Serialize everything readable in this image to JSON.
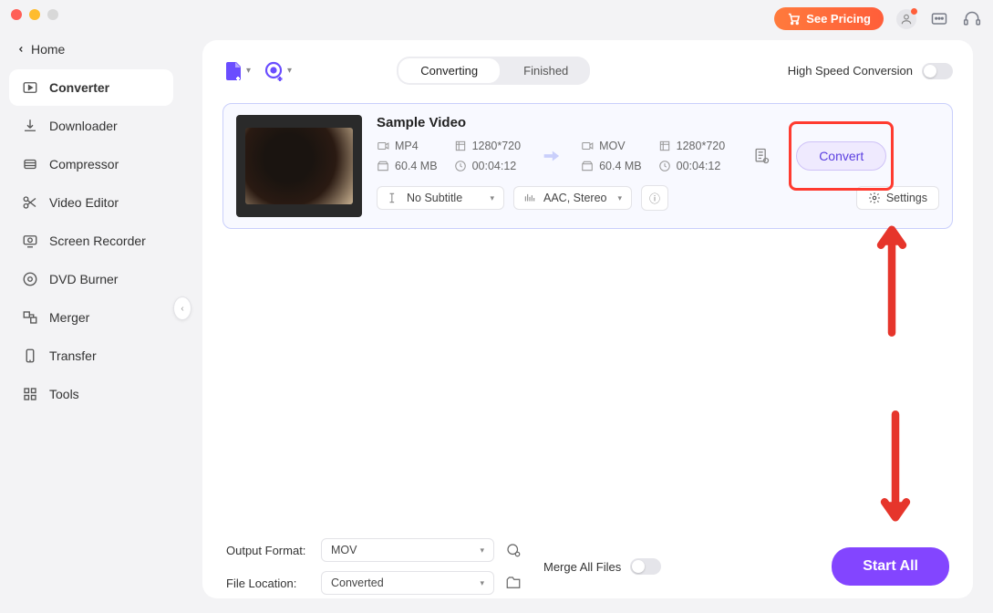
{
  "header": {
    "see_pricing": "See Pricing"
  },
  "home_label": "Home",
  "sidebar": {
    "items": [
      {
        "label": "Converter",
        "active": true
      },
      {
        "label": "Downloader"
      },
      {
        "label": "Compressor"
      },
      {
        "label": "Video Editor"
      },
      {
        "label": "Screen Recorder"
      },
      {
        "label": "DVD Burner"
      },
      {
        "label": "Merger"
      },
      {
        "label": "Transfer"
      },
      {
        "label": "Tools"
      }
    ]
  },
  "tabs": {
    "converting": "Converting",
    "finished": "Finished"
  },
  "hsc_label": "High Speed Conversion",
  "file": {
    "title": "Sample Video",
    "src_format": "MP4",
    "src_res": "1280*720",
    "src_size": "60.4 MB",
    "src_dur": "00:04:12",
    "dst_format": "MOV",
    "dst_res": "1280*720",
    "dst_size": "60.4 MB",
    "dst_dur": "00:04:12",
    "subtitle": "No Subtitle",
    "audio": "AAC, Stereo",
    "settings": "Settings",
    "convert": "Convert"
  },
  "footer": {
    "output_format_label": "Output Format:",
    "output_format": "MOV",
    "file_location_label": "File Location:",
    "file_location": "Converted",
    "merge_label": "Merge All Files",
    "start_all": "Start All"
  }
}
